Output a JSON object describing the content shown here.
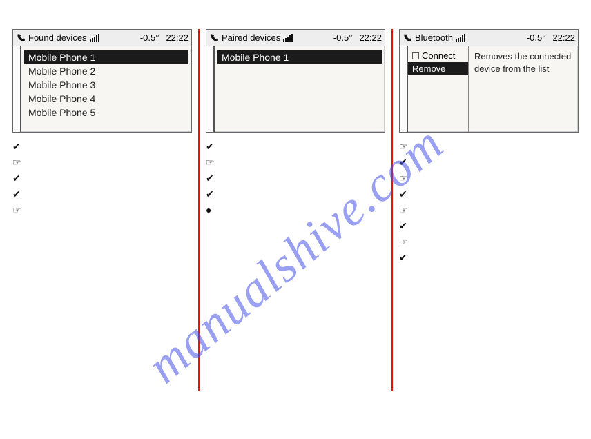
{
  "status": {
    "temp": "-0.5°",
    "time": "22:22"
  },
  "screens": {
    "found": {
      "title": "Found devices",
      "items": [
        "Mobile Phone 1",
        "Mobile Phone 2",
        "Mobile Phone 3",
        "Mobile Phone 4",
        "Mobile Phone 5"
      ],
      "selected_index": 0
    },
    "paired": {
      "title": "Paired devices",
      "items": [
        "Mobile Phone 1"
      ],
      "selected_index": 0
    },
    "bluetooth": {
      "title": "Bluetooth",
      "menu": [
        {
          "label": "Connect",
          "checkbox": true
        },
        {
          "label": "Remove"
        }
      ],
      "selected_index": 1,
      "description": "Removes the connected device from the list"
    }
  },
  "bullets": {
    "col1": [
      "check",
      "hand",
      "check",
      "check",
      "hand"
    ],
    "col2": [
      "check",
      "hand",
      "check",
      "check",
      "dot"
    ],
    "col3": [
      "hand",
      "check",
      "hand",
      "check",
      "hand",
      "check",
      "hand",
      "check"
    ]
  },
  "marks": {
    "check": "✔",
    "hand": "☞",
    "dot": "●"
  },
  "watermark": "manualshive.com"
}
